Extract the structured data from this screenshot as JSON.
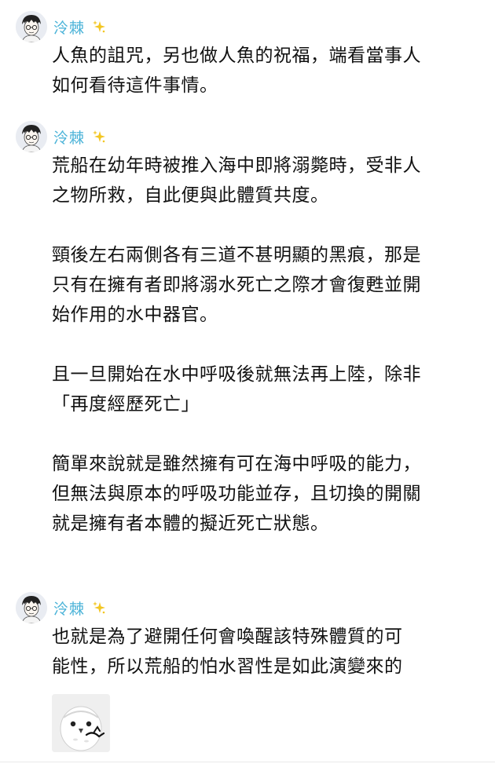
{
  "messages": [
    {
      "username": "泠棘",
      "avatar_icon": "avatar-icon",
      "badge_icon": "sparkle-icon",
      "paragraphs": [
        [
          "人魚的詛咒，另也做人魚的祝福，端看當事人",
          "如何看待這件事情。"
        ]
      ]
    },
    {
      "username": "泠棘",
      "avatar_icon": "avatar-icon",
      "badge_icon": "sparkle-icon",
      "paragraphs": [
        [
          "荒船在幼年時被推入海中即將溺斃時，受非人",
          "之物所救，自此便與此體質共度。"
        ],
        [
          "頸後左右兩側各有三道不甚明顯的黑痕，那是",
          "只有在擁有者即將溺水死亡之際才會復甦並開",
          "始作用的水中器官。"
        ],
        [
          "且一旦開始在水中呼吸後就無法再上陸，除非",
          "「再度經歷死亡」"
        ],
        [
          "簡單來說就是雖然擁有可在海中呼吸的能力，",
          "但無法與原本的呼吸功能並存，且切換的開關",
          "就是擁有者本體的擬近死亡狀態。"
        ]
      ]
    },
    {
      "username": "泠棘",
      "avatar_icon": "avatar-icon",
      "badge_icon": "sparkle-icon",
      "paragraphs": [
        [
          "也就是為了避開任何會喚醒該特殊體質的可",
          "能性，所以荒船的怕水習性是如此演變來的"
        ]
      ],
      "sticker_icon": "owl-sticker-icon"
    }
  ],
  "colors": {
    "username": "#4bb3d8",
    "sparkle": "#f3c623",
    "text": "#111111"
  }
}
